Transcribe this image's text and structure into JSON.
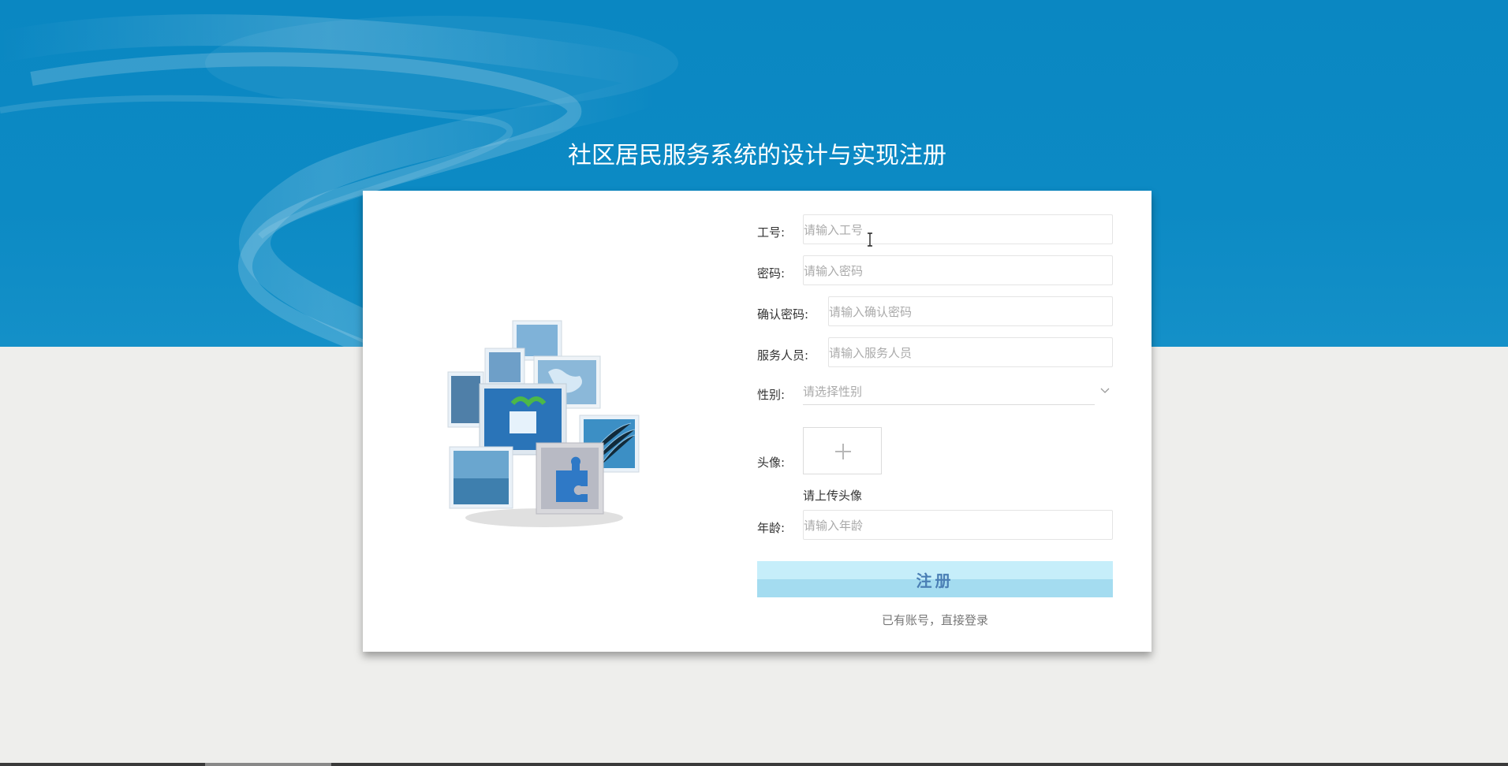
{
  "page": {
    "title": "社区居民服务系统的设计与实现注册"
  },
  "form": {
    "employee_id": {
      "label": "工号:",
      "placeholder": "请输入工号",
      "value": ""
    },
    "password": {
      "label": "密码:",
      "placeholder": "请输入密码",
      "value": ""
    },
    "confirm_password": {
      "label": "确认密码:",
      "placeholder": "请输入确认密码",
      "value": ""
    },
    "service_staff": {
      "label": "服务人员:",
      "placeholder": "请输入服务人员",
      "value": ""
    },
    "gender": {
      "label": "性别:",
      "placeholder": "请选择性别",
      "icon": "chevron-down-icon"
    },
    "avatar": {
      "label": "头像:",
      "hint": "请上传头像",
      "icon": "plus-icon"
    },
    "age": {
      "label": "年龄:",
      "placeholder": "请输入年龄",
      "value": ""
    }
  },
  "actions": {
    "register_label": "注册",
    "login_link": "已有账号，直接登录"
  },
  "colors": {
    "banner": "#0a87c2",
    "background": "#eeeeec",
    "card": "#ffffff",
    "button_top": "#c6eefa",
    "button_bottom": "#a4dcf0",
    "button_text": "#4a7fb5"
  }
}
